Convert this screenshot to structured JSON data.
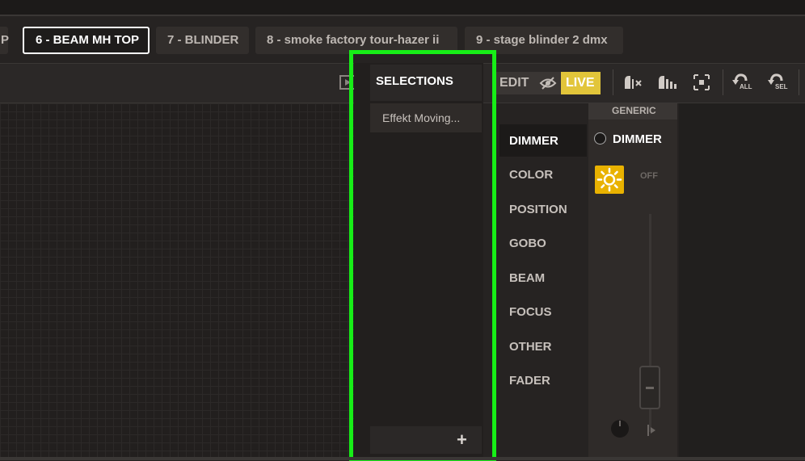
{
  "tabs": [
    {
      "label": "P"
    },
    {
      "label": "6 - BEAM MH TOP"
    },
    {
      "label": "7 - BLINDER"
    },
    {
      "label": "8 - smoke factory tour-hazer ii"
    },
    {
      "label": "9 - stage blinder 2 dmx"
    }
  ],
  "selections": {
    "title": "SELECTIONS",
    "items": [
      "Effekt Moving..."
    ],
    "add_label": "+"
  },
  "mode": {
    "edit_label": "EDIT",
    "live_label": "LIVE"
  },
  "toolbar": {
    "undo_all_label": "ALL",
    "undo_sel_label": "SEL"
  },
  "categories": [
    "DIMMER",
    "COLOR",
    "POSITION",
    "GOBO",
    "BEAM",
    "FOCUS",
    "OTHER",
    "FADER"
  ],
  "generic": {
    "header": "GENERIC",
    "channel_label": "DIMMER",
    "state": "OFF"
  },
  "colors": {
    "accent_live": "#e2c53a",
    "highlight_border": "#17ee17",
    "sun_icon": "#e9b200"
  }
}
